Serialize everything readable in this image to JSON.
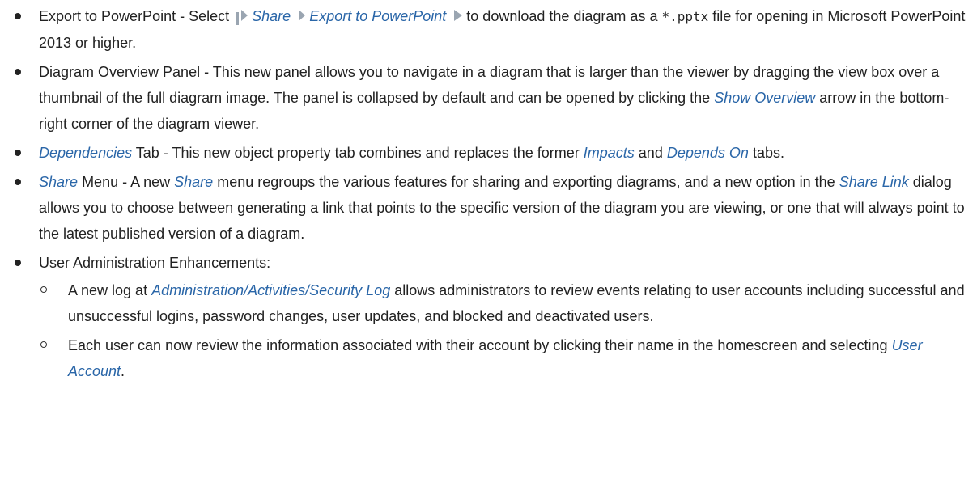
{
  "colors": {
    "link": "#2a66a8",
    "text": "#222222"
  },
  "items": [
    {
      "export_lead": "Export to PowerPoint - Select",
      "menu_path": [
        "Share",
        "Export to PowerPoint"
      ],
      "export_mid": "to download the diagram as a",
      "file_ext": "*.pptx",
      "export_tail": "file for opening in Microsoft PowerPoint 2013 or higher."
    },
    {
      "overview_lead": "Diagram Overview Panel - This new panel allows you to navigate in a diagram that is larger than the viewer by dragging the view box over a thumbnail of the full diagram image. The panel is collapsed by default and can be opened by clicking the",
      "overview_link": "Show Overview",
      "overview_tail": "arrow in the bottom-right corner of the diagram viewer."
    },
    {
      "dep_link": "Dependencies",
      "dep_mid": "Tab - This new object property tab combines and replaces the former",
      "impacts_link": "Impacts",
      "and_text": "and",
      "depends_link": "Depends On",
      "dep_tail": "tabs."
    },
    {
      "share_link": "Share",
      "share_mid1": "Menu - A new",
      "share_link2": "Share",
      "share_mid2": "menu regroups the various features for sharing and exporting diagrams, and a new option in the",
      "share_link3": "Share Link",
      "share_tail": "dialog allows you to choose between generating a link that points to the specific version of the diagram you are viewing, or one that will always point to the latest published version of a diagram."
    },
    {
      "admin_heading": "User Administration Enhancements:",
      "sub_items": [
        {
          "lead": "A new log at",
          "link": "Administration/Activities/Security Log",
          "tail": "allows administrators to review events relating to user accounts including successful and unsuccessful logins, password changes, user updates, and blocked and deactivated users."
        },
        {
          "lead": "Each user can now review the information associated with their account by clicking their name in the homescreen and selecting",
          "link": "User Account",
          "tail": "."
        }
      ]
    }
  ],
  "icons": {
    "menu_separator": "chevron-right-icon",
    "menu_end": "triangle-right-icon"
  }
}
